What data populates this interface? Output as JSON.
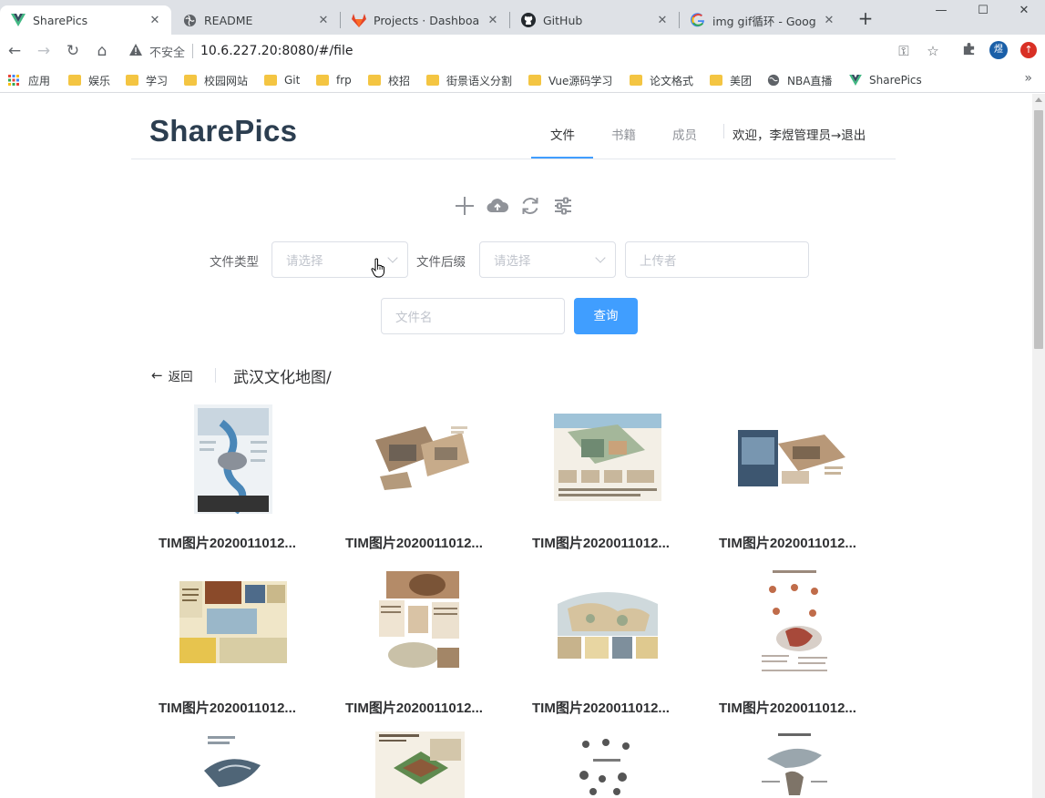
{
  "browser": {
    "tabs": [
      {
        "title": "SharePics",
        "icon": "vue-icon",
        "active": true
      },
      {
        "title": "README",
        "icon": "globe-icon",
        "active": false
      },
      {
        "title": "Projects · Dashboard",
        "icon": "gitlab-icon",
        "active": false
      },
      {
        "title": "GitHub",
        "icon": "github-icon",
        "active": false
      },
      {
        "title": "img gif循环 - Google",
        "icon": "google-icon",
        "active": false
      }
    ],
    "address": {
      "security_label": "不安全",
      "url": "10.6.227.20:8080/#/file"
    },
    "profile_initial": "煜",
    "bookmarks": [
      {
        "label": "应用",
        "icon": "apps-grid-icon"
      },
      {
        "label": "娱乐",
        "icon": "folder-icon"
      },
      {
        "label": "学习",
        "icon": "folder-icon"
      },
      {
        "label": "校园网站",
        "icon": "folder-icon"
      },
      {
        "label": "Git",
        "icon": "folder-icon"
      },
      {
        "label": "frp",
        "icon": "folder-icon"
      },
      {
        "label": "校招",
        "icon": "folder-icon"
      },
      {
        "label": "街景语义分割",
        "icon": "folder-icon"
      },
      {
        "label": "Vue源码学习",
        "icon": "folder-icon"
      },
      {
        "label": "论文格式",
        "icon": "folder-icon"
      },
      {
        "label": "美团",
        "icon": "folder-icon"
      },
      {
        "label": "NBA直播",
        "icon": "globe-icon"
      },
      {
        "label": "SharePics",
        "icon": "vue-icon"
      }
    ]
  },
  "app": {
    "logo": "SharePics",
    "nav": {
      "files": "文件",
      "books": "书籍",
      "members": "成员",
      "active": "files"
    },
    "user": {
      "welcome": "欢迎，李煜管理员",
      "logout": "→退出"
    },
    "actions": [
      "plus-icon",
      "cloud-upload-icon",
      "refresh-icon",
      "sliders-icon"
    ],
    "filters": {
      "file_type_label": "文件类型",
      "file_type_placeholder": "请选择",
      "file_ext_label": "文件后缀",
      "file_ext_placeholder": "请选择",
      "uploader_placeholder": "上传者",
      "filename_placeholder": "文件名",
      "query_button": "查询"
    },
    "breadcrumb": {
      "back": "返回",
      "folder": "武汉文化地图/"
    },
    "files": [
      {
        "name": "TIM图片2020011012..."
      },
      {
        "name": "TIM图片2020011012..."
      },
      {
        "name": "TIM图片2020011012..."
      },
      {
        "name": "TIM图片2020011012..."
      },
      {
        "name": "TIM图片2020011012..."
      },
      {
        "name": "TIM图片2020011012..."
      },
      {
        "name": "TIM图片2020011012..."
      },
      {
        "name": "TIM图片2020011012..."
      },
      {
        "name": ""
      },
      {
        "name": ""
      },
      {
        "name": ""
      },
      {
        "name": ""
      }
    ]
  }
}
